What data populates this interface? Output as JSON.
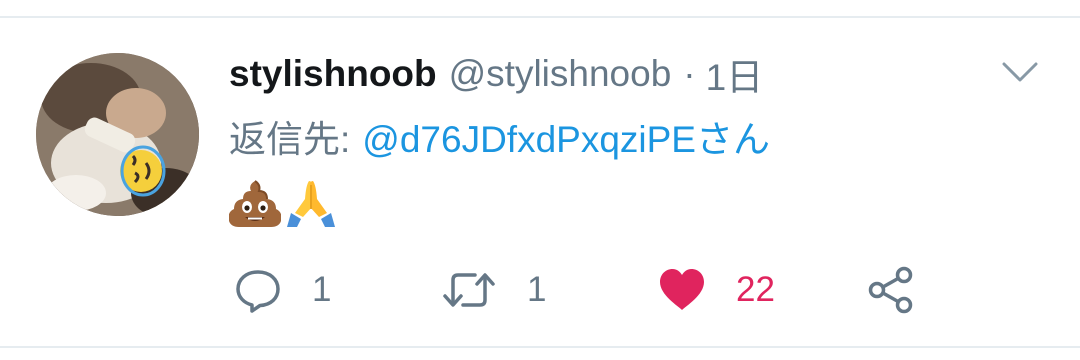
{
  "tweet": {
    "display_name": "stylishnoob",
    "handle": "@stylishnoob",
    "separator": "·",
    "time": "1日",
    "reply_prefix": "返信先:",
    "reply_target": "@d76JDfxdPxqziPEさん",
    "emoji": [
      "pile-of-poo",
      "folded-hands"
    ]
  },
  "actions": {
    "reply_count": "1",
    "retweet_count": "1",
    "like_count": "22",
    "liked": true
  },
  "colors": {
    "name": "#14171a",
    "secondary": "#657786",
    "link": "#1b95e0",
    "like": "#e0245e",
    "divider": "#e6ecf0"
  },
  "icons": {
    "menu": "chevron-down-icon",
    "reply": "reply-bubble-icon",
    "retweet": "retweet-icon",
    "like": "heart-icon",
    "share": "share-icon"
  }
}
